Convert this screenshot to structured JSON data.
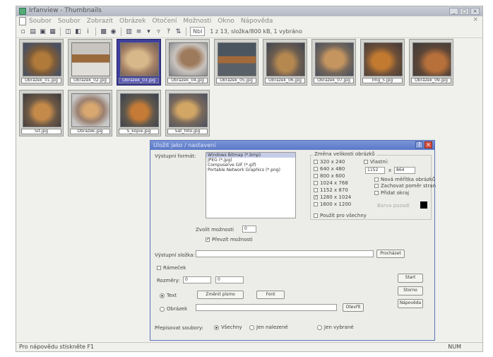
{
  "window": {
    "title": "Irfanview - Thumbnails"
  },
  "menu": [
    "Soubor",
    "Soubor",
    "Zobrazit",
    "Obrázek",
    "Otočení",
    "Možnosti",
    "Okno",
    "Nápověda"
  ],
  "toolbar": {
    "field_value": "Nbl",
    "status_text": "1 z 13, složka/800 kB, 1 vybráno"
  },
  "thumbnails": [
    {
      "caption": "Obrázek_01.jpg",
      "selected": false
    },
    {
      "caption": "Obrázek_02.jpg",
      "selected": false
    },
    {
      "caption": "Obrázek_03.jpg",
      "selected": true
    },
    {
      "caption": "Obrázek_04.jpg",
      "selected": false
    },
    {
      "caption": "Obrázek_05.jpg",
      "selected": false
    },
    {
      "caption": "Obrázek_06.jpg",
      "selected": false
    },
    {
      "caption": "Obrázek_07.jpg",
      "selected": false
    },
    {
      "caption": "Img_5.jpg",
      "selected": false
    },
    {
      "caption": "Obrázek_09.jpg",
      "selected": false
    },
    {
      "caption": "Sit.jpg",
      "selected": false
    },
    {
      "caption": "Obrázek.jpg",
      "selected": false
    },
    {
      "caption": "S_kopie.jpg",
      "selected": false
    },
    {
      "caption": "Sat_foto.jpg",
      "selected": false
    }
  ],
  "dialog": {
    "title": "Uložit jako / nastavení",
    "format_label": "Výstupní formát:",
    "format_options": [
      "Windows Bitmap (*.bmp)",
      "JPEG (*.jpg)",
      "Compuserve GIF (*.gif)",
      "Portable Network Graphics (*.png)"
    ],
    "selected_format": 0,
    "options_button": "Zvolit možnosti",
    "quality_value": "0",
    "quality_checkbox": "Převzít možnosti",
    "group_title": "Změna velikosti obrázků",
    "sizes": [
      "320 x 240",
      "640 x 480",
      "800 x 600",
      "1024 x 768",
      "1152 x 870",
      "1280 x 1024",
      "1600 x 1200"
    ],
    "sizes_checked": 5,
    "custom_label": "Vlastní:",
    "custom_width": "1152",
    "custom_x": "x",
    "custom_height": "864",
    "opt_keep_ratio": "Nová měřítka obrázků",
    "opt_preserve": "Zachovat poměr stran",
    "opt_bg": "Přidat okraj",
    "bg_color_label": "Barva pozadí",
    "apply_all": "Použít pro všechny",
    "output_folder_label": "Výstupní složka:",
    "output_folder_value": "",
    "browse_button": "Procházet",
    "frame_checkbox": "Rámeček",
    "frame_label": "Rozměry:",
    "frame_x": "0",
    "frame_y": "0",
    "text_radio": "Text",
    "font_button": "Změnit písmo",
    "preview_button": "Font",
    "image_radio": "Obrázek",
    "image_path": "",
    "open_button": "Otevřít",
    "start_button": "Start",
    "cancel_button": "Storno",
    "help_button": "Nápověda",
    "overwrite_label": "Přepisovat soubory:",
    "overwrite_options": [
      "Všechny",
      "Jen nalezené",
      "Jen vybrané"
    ],
    "overwrite_selected": 0
  },
  "statusbar": {
    "left": "Pro nápovědu stiskněte F1",
    "right": "NUM"
  }
}
